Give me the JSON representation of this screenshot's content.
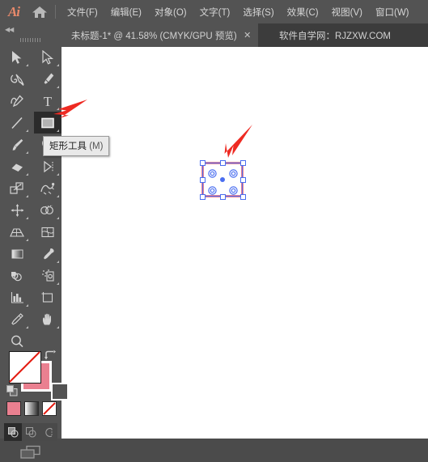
{
  "app": {
    "name": "Adobe Illustrator",
    "logo_text": "Ai",
    "home_icon": "home-icon"
  },
  "menubar": {
    "items": [
      {
        "label": "文件(F)",
        "name": "menu-file"
      },
      {
        "label": "编辑(E)",
        "name": "menu-edit"
      },
      {
        "label": "对象(O)",
        "name": "menu-object"
      },
      {
        "label": "文字(T)",
        "name": "menu-type"
      },
      {
        "label": "选择(S)",
        "name": "menu-select"
      },
      {
        "label": "效果(C)",
        "name": "menu-effect"
      },
      {
        "label": "视图(V)",
        "name": "menu-view"
      },
      {
        "label": "窗口(W)",
        "name": "menu-window"
      }
    ]
  },
  "tabbar": {
    "document_tab": {
      "title": "未标题-1* @ 41.58% (CMYK/GPU 预览)",
      "close_label": "✕"
    },
    "watermark": "软件自学网：RJZXW.COM"
  },
  "toolpanel": {
    "collapse_label": "◀◀",
    "grip": "drag-grip",
    "tools": [
      {
        "name": "selection-tool",
        "label": "选择工具",
        "icon": "arrow-cursor-icon",
        "has_flyout": true,
        "active": false
      },
      {
        "name": "direct-selection-tool",
        "label": "直接选择工具",
        "icon": "hollow-arrow-cursor-icon",
        "has_flyout": true,
        "active": false
      },
      {
        "name": "magic-wand-tool",
        "label": "魔棒工具",
        "icon": "magic-wand-icon",
        "has_flyout": false,
        "active": false
      },
      {
        "name": "pen-tool",
        "label": "钢笔工具",
        "icon": "pen-nib-icon",
        "has_flyout": true,
        "active": false
      },
      {
        "name": "curvature-tool",
        "label": "曲率工具",
        "icon": "curvature-icon",
        "has_flyout": false,
        "active": false
      },
      {
        "name": "type-tool",
        "label": "文字工具",
        "icon": "type-t-icon",
        "has_flyout": true,
        "active": false
      },
      {
        "name": "line-segment-tool",
        "label": "直线段工具",
        "icon": "line-segment-icon",
        "has_flyout": true,
        "active": false
      },
      {
        "name": "rectangle-tool",
        "label": "矩形工具",
        "icon": "rectangle-icon",
        "has_flyout": true,
        "active": true
      },
      {
        "name": "paintbrush-tool",
        "label": "画笔工具",
        "icon": "paintbrush-icon",
        "has_flyout": true,
        "active": false
      },
      {
        "name": "shaper-tool",
        "label": "Shaper 工具",
        "icon": "shaper-icon",
        "has_flyout": true,
        "active": false
      },
      {
        "name": "eraser-tool",
        "label": "橡皮擦工具",
        "icon": "eraser-icon",
        "has_flyout": true,
        "active": false
      },
      {
        "name": "rotate-tool",
        "label": "旋转工具",
        "icon": "rotate-icon",
        "has_flyout": true,
        "active": false
      },
      {
        "name": "scale-tool",
        "label": "比例缩放工具",
        "icon": "scale-icon",
        "has_flyout": true,
        "active": false
      },
      {
        "name": "width-tool",
        "label": "宽度工具",
        "icon": "width-warp-icon",
        "has_flyout": true,
        "active": false
      },
      {
        "name": "free-transform-tool",
        "label": "自由变换工具",
        "icon": "free-transform-icon",
        "has_flyout": true,
        "active": false
      },
      {
        "name": "shape-builder-tool",
        "label": "形状生成器工具",
        "icon": "shape-builder-icon",
        "has_flyout": true,
        "active": false
      },
      {
        "name": "perspective-grid-tool",
        "label": "透视网格工具",
        "icon": "perspective-grid-icon",
        "has_flyout": true,
        "active": false
      },
      {
        "name": "mesh-tool",
        "label": "网格工具",
        "icon": "mesh-icon",
        "has_flyout": false,
        "active": false
      },
      {
        "name": "gradient-tool",
        "label": "渐变工具",
        "icon": "gradient-icon",
        "has_flyout": false,
        "active": false
      },
      {
        "name": "eyedropper-tool",
        "label": "吸管工具",
        "icon": "eyedropper-icon",
        "has_flyout": true,
        "active": false
      },
      {
        "name": "blend-tool",
        "label": "混合工具",
        "icon": "blend-icon",
        "has_flyout": false,
        "active": false
      },
      {
        "name": "symbol-sprayer-tool",
        "label": "符号喷枪工具",
        "icon": "symbol-sprayer-icon",
        "has_flyout": true,
        "active": false
      },
      {
        "name": "column-graph-tool",
        "label": "柱形图工具",
        "icon": "bar-chart-icon",
        "has_flyout": true,
        "active": false
      },
      {
        "name": "artboard-tool",
        "label": "画板工具",
        "icon": "artboard-icon",
        "has_flyout": false,
        "active": false
      },
      {
        "name": "slice-tool",
        "label": "切片工具",
        "icon": "slice-knife-icon",
        "has_flyout": true,
        "active": false
      },
      {
        "name": "hand-tool",
        "label": "抓手工具",
        "icon": "hand-icon",
        "has_flyout": true,
        "active": false
      },
      {
        "name": "zoom-tool",
        "label": "缩放工具",
        "icon": "magnifier-icon",
        "has_flyout": false,
        "active": false
      }
    ]
  },
  "tooltip": {
    "visible": true,
    "label": "矩形工具",
    "shortcut": "(M)"
  },
  "color_controls": {
    "fill": {
      "name": "fill-swatch",
      "value": "none",
      "color": "#ffffff"
    },
    "stroke": {
      "name": "stroke-swatch",
      "value": "pink",
      "color": "#ea8090"
    },
    "swap_label": "swap-fill-stroke-icon",
    "default_label": "default-fill-stroke-icon",
    "modes": [
      {
        "name": "color-mode-button",
        "icon": "solid-color-icon",
        "color": "#ea8090"
      },
      {
        "name": "gradient-mode-button",
        "icon": "gradient-icon"
      },
      {
        "name": "none-mode-button",
        "icon": "none-slash-icon"
      }
    ],
    "draw_modes": [
      {
        "name": "draw-normal-button",
        "icon": "draw-normal-icon",
        "selected": true
      },
      {
        "name": "draw-behind-button",
        "icon": "draw-behind-icon",
        "selected": false
      },
      {
        "name": "draw-inside-button",
        "icon": "draw-inside-icon",
        "selected": false
      }
    ],
    "screen_mode": {
      "name": "change-screen-mode-button",
      "icon": "screen-mode-icon"
    }
  },
  "canvas": {
    "background": "#ffffff",
    "zoom": "41.58%",
    "selection": {
      "object": "rectangle",
      "stroke_color": "#ea8090",
      "fill_color": "#ffffff",
      "selection_color": "#4a6ef0",
      "handles": 8,
      "corner_widgets": 4,
      "center_point": true
    }
  },
  "annotations": {
    "color": "#ee2a22",
    "arrows": [
      {
        "name": "arrow-to-rectangle-tool",
        "direction": "left",
        "target": "rectangle-tool"
      },
      {
        "name": "arrow-to-shape",
        "direction": "down-left",
        "target": "canvas-rectangle"
      }
    ]
  }
}
